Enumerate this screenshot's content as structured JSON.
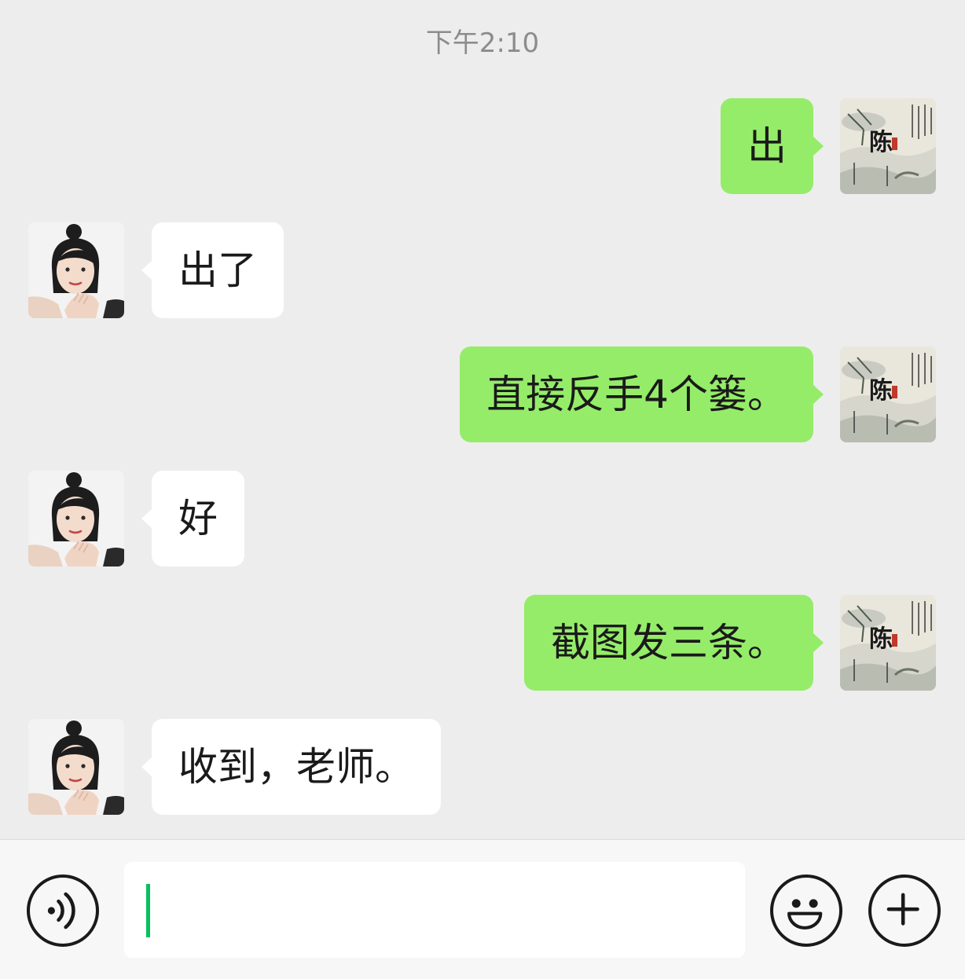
{
  "timestamp": "下午2:10",
  "messages": [
    {
      "side": "sent",
      "text": "出"
    },
    {
      "side": "received",
      "text": "出了"
    },
    {
      "side": "sent",
      "text": "直接反手4个篓。"
    },
    {
      "side": "received",
      "text": "好"
    },
    {
      "side": "sent",
      "text": "截图发三条。"
    },
    {
      "side": "received",
      "text": "收到，老师。"
    }
  ],
  "self_avatar": {
    "calligraphy_char": "陈",
    "icon": "ink-painting-avatar"
  },
  "contact_avatar": {
    "icon": "portrait-avatar"
  },
  "input_bar": {
    "voice_icon": "voice-icon",
    "text_value": "",
    "emoji_icon": "emoji-icon",
    "plus_icon": "plus-icon"
  },
  "colors": {
    "background": "#ededed",
    "sent_bubble": "#95ec69",
    "received_bubble": "#ffffff",
    "caret": "#07c160"
  }
}
